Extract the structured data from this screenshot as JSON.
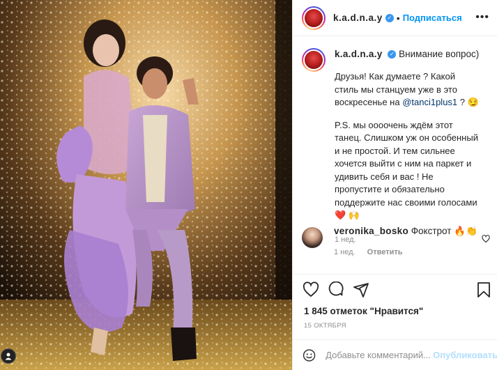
{
  "post": {
    "username": "k.a.d.n.a.y",
    "follow_label": "Подписаться",
    "more_label": "•••",
    "dot_separator": "•"
  },
  "caption": {
    "username": "k.a.d.n.a.y",
    "headline": "Внимание вопрос)",
    "paragraph1_before": "Друзья! Как думаете ? Какой стиль мы станцуем уже в это воскресенье на ",
    "mention": "@tanci1plus1",
    "paragraph1_after": " ? 😏",
    "paragraph2": "P.S. мы оооочень ждём этот танец. Слишком уж он особенный и не простой. И тем сильнее хочется выйти с ним на паркет и удивить себя и вас ! Не пропустите и обязательно поддержите нас своими голосами ❤️ 🙌",
    "time": "1 нед."
  },
  "comment": {
    "username": "veronika_bosko",
    "text": "Фокстрот 🔥👏",
    "time": "1 нед.",
    "reply_label": "Ответить"
  },
  "likes_text": "1 845 отметок \"Нравится\"",
  "date_text": "15 ОКТЯБРЯ",
  "add_comment": {
    "placeholder": "Добавьте комментарий...",
    "publish_label": "Опубликовать"
  },
  "colors": {
    "accent": "#0095f6",
    "verified": "#3897f0",
    "publish_disabled": "#b2dffc",
    "muted": "#8e8e8e",
    "heart_red": "#ed4956"
  },
  "icons": [
    "verified-badge-icon",
    "more-options-icon",
    "heart-icon",
    "comment-icon",
    "share-icon",
    "bookmark-icon",
    "emoji-icon"
  ]
}
